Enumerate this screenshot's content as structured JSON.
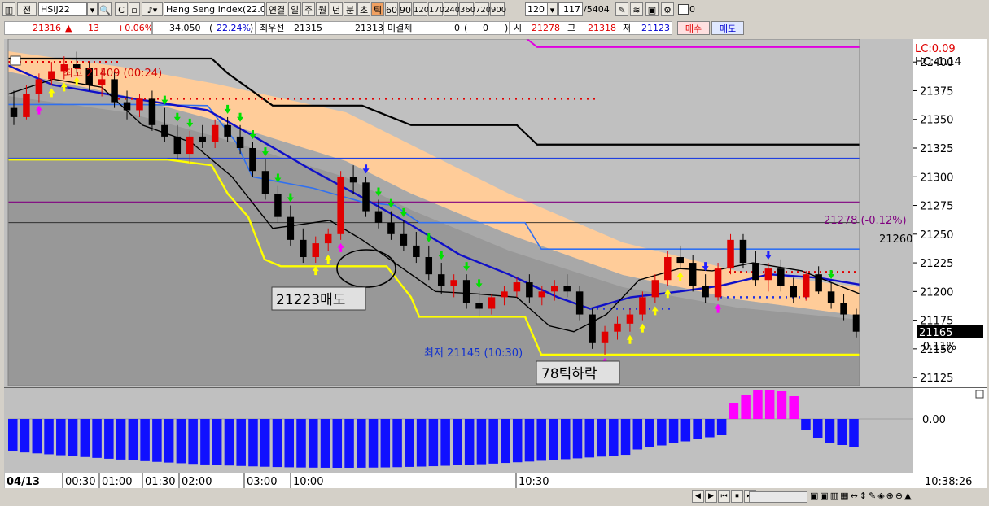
{
  "toolbar": {
    "label_jeon": "전",
    "symbol": "HSIJ22",
    "name": "Hang Seng Index(22.0",
    "period_buttons": [
      "연결",
      "일",
      "주",
      "월",
      "년",
      "분",
      "초",
      "틱",
      "60",
      "90",
      "120",
      "170",
      "240",
      "360",
      "720",
      "900"
    ],
    "active_period": "틱",
    "tick_count": "120",
    "position": "117",
    "total": "/5404",
    "checkbox_label": "0"
  },
  "quote": {
    "price": "21316",
    "change": "13",
    "change_pct": "+0.06%",
    "volume": "34,050",
    "volume_pct": "22.24%",
    "best_ask_label": "최우선",
    "best_ask": "21315",
    "best_bid": "21313",
    "unfilled_label": "미결제",
    "unfilled": "0",
    "unfilled_change": "0",
    "open_label": "시",
    "open": "21278",
    "high_label": "고",
    "high": "21318",
    "low_label": "저",
    "low": "21123",
    "buy_label": "매수",
    "sell_label": "매도",
    "colors": {
      "up": "#e00000",
      "down": "#0000d0"
    }
  },
  "chart_data": {
    "type": "candlestick",
    "y_range": [
      21118,
      21420
    ],
    "y_ticks": [
      21400,
      21375,
      21350,
      21325,
      21300,
      21275,
      21250,
      21225,
      21200,
      21175,
      21150,
      21125
    ],
    "corner_labels": [
      "LC:0.09",
      "HC:-1.14"
    ],
    "current_price": "21165",
    "current_pct": "-0.11%",
    "right_price_label": "21260",
    "open_line_label": "21278 (-0.12%)",
    "high_annotation": "최고 21409 (00:24)",
    "low_annotation": "최저 21145 (10:30)",
    "box_label_sell": "21223매도",
    "box_label_drop": "78틱하락",
    "time_labels": [
      "04/13",
      "00:30",
      "01:00",
      "01:30",
      "02:00",
      "03:00",
      "10:00",
      "10:30",
      "10:38:26"
    ],
    "oscillator_zero_label": "0.00",
    "candles": [
      [
        21360,
        21375,
        21345,
        21352
      ],
      [
        21352,
        21380,
        21350,
        21372
      ],
      [
        21372,
        21390,
        21365,
        21385
      ],
      [
        21385,
        21400,
        21380,
        21392
      ],
      [
        21392,
        21405,
        21385,
        21398
      ],
      [
        21398,
        21409,
        21390,
        21395
      ],
      [
        21395,
        21400,
        21375,
        21380
      ],
      [
        21380,
        21395,
        21370,
        21385
      ],
      [
        21385,
        21392,
        21360,
        21365
      ],
      [
        21365,
        21375,
        21350,
        21358
      ],
      [
        21358,
        21372,
        21352,
        21368
      ],
      [
        21368,
        21375,
        21340,
        21345
      ],
      [
        21345,
        21360,
        21330,
        21335
      ],
      [
        21335,
        21345,
        21315,
        21320
      ],
      [
        21320,
        21340,
        21312,
        21335
      ],
      [
        21335,
        21345,
        21325,
        21330
      ],
      [
        21330,
        21350,
        21325,
        21345
      ],
      [
        21345,
        21352,
        21330,
        21335
      ],
      [
        21335,
        21345,
        21320,
        21325
      ],
      [
        21325,
        21330,
        21300,
        21305
      ],
      [
        21305,
        21315,
        21280,
        21285
      ],
      [
        21285,
        21292,
        21260,
        21265
      ],
      [
        21265,
        21275,
        21240,
        21245
      ],
      [
        21245,
        21255,
        21225,
        21230
      ],
      [
        21230,
        21248,
        21225,
        21242
      ],
      [
        21242,
        21255,
        21235,
        21250
      ],
      [
        21250,
        21305,
        21245,
        21300
      ],
      [
        21300,
        21310,
        21285,
        21295
      ],
      [
        21295,
        21300,
        21265,
        21270
      ],
      [
        21270,
        21280,
        21255,
        21260
      ],
      [
        21260,
        21270,
        21245,
        21250
      ],
      [
        21250,
        21262,
        21235,
        21240
      ],
      [
        21240,
        21252,
        21225,
        21230
      ],
      [
        21230,
        21240,
        21210,
        21215
      ],
      [
        21215,
        21225,
        21198,
        21205
      ],
      [
        21205,
        21215,
        21195,
        21210
      ],
      [
        21210,
        21215,
        21185,
        21190
      ],
      [
        21190,
        21200,
        21178,
        21185
      ],
      [
        21185,
        21198,
        21180,
        21195
      ],
      [
        21195,
        21205,
        21188,
        21200
      ],
      [
        21200,
        21212,
        21195,
        21208
      ],
      [
        21208,
        21215,
        21190,
        21195
      ],
      [
        21195,
        21205,
        21188,
        21200
      ],
      [
        21200,
        21210,
        21192,
        21205
      ],
      [
        21205,
        21215,
        21195,
        21200
      ],
      [
        21200,
        21205,
        21175,
        21180
      ],
      [
        21180,
        21185,
        21150,
        21155
      ],
      [
        21155,
        21170,
        21145,
        21165
      ],
      [
        21165,
        21178,
        21158,
        21172
      ],
      [
        21172,
        21185,
        21165,
        21180
      ],
      [
        21180,
        21200,
        21175,
        21195
      ],
      [
        21195,
        21215,
        21190,
        21210
      ],
      [
        21210,
        21235,
        21205,
        21230
      ],
      [
        21230,
        21240,
        21220,
        21225
      ],
      [
        21225,
        21232,
        21200,
        21205
      ],
      [
        21205,
        21215,
        21190,
        21195
      ],
      [
        21195,
        21225,
        21192,
        21220
      ],
      [
        21220,
        21250,
        21215,
        21245
      ],
      [
        21245,
        21250,
        21220,
        21225
      ],
      [
        21225,
        21235,
        21205,
        21210
      ],
      [
        21210,
        21225,
        21200,
        21220
      ],
      [
        21220,
        21228,
        21200,
        21205
      ],
      [
        21205,
        21212,
        21190,
        21195
      ],
      [
        21195,
        21218,
        21192,
        21215
      ],
      [
        21215,
        21222,
        21198,
        21200
      ],
      [
        21200,
        21208,
        21185,
        21190
      ],
      [
        21190,
        21198,
        21175,
        21180
      ],
      [
        21180,
        21185,
        21160,
        21165
      ]
    ],
    "oscillator": {
      "negative_bars": 60,
      "positive_bars": 6,
      "tail_negative_bars": 5
    }
  },
  "bottom": {
    "nav_buttons": [
      "◀",
      "▶",
      "⏮",
      "⏹",
      "⏭"
    ]
  }
}
